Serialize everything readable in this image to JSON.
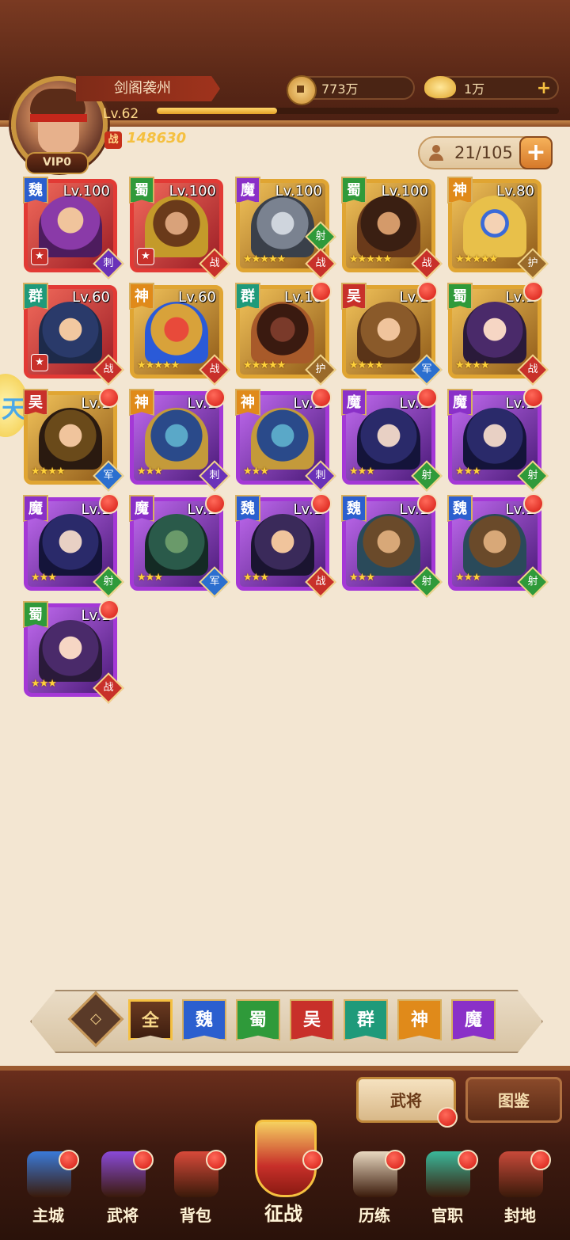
{
  "player": {
    "name": "剑阁袭州",
    "level": "Lv.62",
    "vip": "VIP0",
    "power": "148630",
    "power_icon": "战",
    "xp_fraction": 0.3
  },
  "resources": {
    "copper": "773万",
    "gold": "1万"
  },
  "capacity": "21/105",
  "heroes": [
    {
      "faction": "魏",
      "fclass": "f-wei",
      "lv": "Lv.100",
      "border": "red",
      "stars": "",
      "starbadge": "★",
      "role": "刺",
      "rclass": "r-ci",
      "dot": false,
      "p": "p1"
    },
    {
      "faction": "蜀",
      "fclass": "f-shu",
      "lv": "Lv.100",
      "border": "red",
      "stars": "",
      "starbadge": "★",
      "role": "战",
      "rclass": "r-zhan",
      "dot": false,
      "p": "p2"
    },
    {
      "faction": "魔",
      "fclass": "f-mo",
      "lv": "Lv.100",
      "border": "gold",
      "stars": "★★★★★",
      "starbadge": "",
      "role": "战",
      "rclass": "r-zhan",
      "dot": false,
      "p": "p3",
      "role2": "射",
      "r2class": "r-she"
    },
    {
      "faction": "蜀",
      "fclass": "f-shu",
      "lv": "Lv.100",
      "border": "gold",
      "stars": "★★★★★",
      "starbadge": "",
      "role": "战",
      "rclass": "r-zhan",
      "dot": false,
      "p": "p4"
    },
    {
      "faction": "神",
      "fclass": "f-shen",
      "lv": "Lv.80",
      "border": "gold",
      "stars": "★★★★★",
      "starbadge": "",
      "role": "护",
      "rclass": "r-hu",
      "dot": false,
      "p": "p5"
    },
    {
      "faction": "群",
      "fclass": "f-qun",
      "lv": "Lv.60",
      "border": "red",
      "stars": "",
      "starbadge": "★",
      "role": "战",
      "rclass": "r-zhan",
      "dot": false,
      "p": "p6"
    },
    {
      "faction": "神",
      "fclass": "f-shen",
      "lv": "Lv.60",
      "border": "gold",
      "stars": "★★★★★",
      "starbadge": "",
      "role": "战",
      "rclass": "r-zhan",
      "dot": false,
      "p": "p7"
    },
    {
      "faction": "群",
      "fclass": "f-qun",
      "lv": "Lv.10",
      "border": "gold",
      "stars": "★★★★★",
      "starbadge": "",
      "role": "护",
      "rclass": "r-hu",
      "dot": true,
      "p": "p8"
    },
    {
      "faction": "吴",
      "fclass": "f-wu",
      "lv": "Lv.1",
      "border": "gold",
      "stars": "★★★★",
      "starbadge": "",
      "role": "军",
      "rclass": "r-jun",
      "dot": true,
      "p": "p9"
    },
    {
      "faction": "蜀",
      "fclass": "f-shu",
      "lv": "Lv.1",
      "border": "gold",
      "stars": "★★★★",
      "starbadge": "",
      "role": "战",
      "rclass": "r-zhan",
      "dot": true,
      "p": "p10"
    },
    {
      "faction": "吴",
      "fclass": "f-wu",
      "lv": "Lv.1",
      "border": "gold",
      "stars": "★★★★",
      "starbadge": "",
      "role": "军",
      "rclass": "r-jun",
      "dot": true,
      "p": "p11"
    },
    {
      "faction": "神",
      "fclass": "f-shen",
      "lv": "Lv.1",
      "border": "purple",
      "stars": "★★★",
      "starbadge": "",
      "role": "刺",
      "rclass": "r-ci",
      "dot": true,
      "p": "p12"
    },
    {
      "faction": "神",
      "fclass": "f-shen",
      "lv": "Lv.1",
      "border": "purple",
      "stars": "★★★",
      "starbadge": "",
      "role": "刺",
      "rclass": "r-ci",
      "dot": true,
      "p": "p12"
    },
    {
      "faction": "魔",
      "fclass": "f-mo",
      "lv": "Lv.1",
      "border": "purple",
      "stars": "★★★",
      "starbadge": "",
      "role": "射",
      "rclass": "r-she",
      "dot": true,
      "p": "p13"
    },
    {
      "faction": "魔",
      "fclass": "f-mo",
      "lv": "Lv.1",
      "border": "purple",
      "stars": "★★★",
      "starbadge": "",
      "role": "射",
      "rclass": "r-she",
      "dot": true,
      "p": "p13"
    },
    {
      "faction": "魔",
      "fclass": "f-mo",
      "lv": "Lv.1",
      "border": "purple",
      "stars": "★★★",
      "starbadge": "",
      "role": "射",
      "rclass": "r-she",
      "dot": true,
      "p": "p13"
    },
    {
      "faction": "魔",
      "fclass": "f-mo",
      "lv": "Lv.1",
      "border": "purple",
      "stars": "★★★",
      "starbadge": "",
      "role": "军",
      "rclass": "r-jun",
      "dot": true,
      "p": "p14"
    },
    {
      "faction": "魏",
      "fclass": "f-wei",
      "lv": "Lv.1",
      "border": "purple",
      "stars": "★★★",
      "starbadge": "",
      "role": "战",
      "rclass": "r-zhan",
      "dot": true,
      "p": "p15"
    },
    {
      "faction": "魏",
      "fclass": "f-wei",
      "lv": "Lv.1",
      "border": "purple",
      "stars": "★★★",
      "starbadge": "",
      "role": "射",
      "rclass": "r-she",
      "dot": true,
      "p": "p16"
    },
    {
      "faction": "魏",
      "fclass": "f-wei",
      "lv": "Lv.1",
      "border": "purple",
      "stars": "★★★",
      "starbadge": "",
      "role": "射",
      "rclass": "r-she",
      "dot": true,
      "p": "p16"
    },
    {
      "faction": "蜀",
      "fclass": "f-shu",
      "lv": "Lv.1",
      "border": "purple",
      "stars": "★★★",
      "starbadge": "",
      "role": "战",
      "rclass": "r-zhan",
      "dot": true,
      "p": "p10"
    }
  ],
  "filters": [
    {
      "label": "全",
      "cls": "all"
    },
    {
      "label": "魏",
      "cls": "f-wei"
    },
    {
      "label": "蜀",
      "cls": "f-shu"
    },
    {
      "label": "吴",
      "cls": "f-wu"
    },
    {
      "label": "群",
      "cls": "f-qun"
    },
    {
      "label": "神",
      "cls": "f-shen"
    },
    {
      "label": "魔",
      "cls": "f-mo"
    }
  ],
  "sub_tabs": {
    "heroes": "武将",
    "codex": "图鉴"
  },
  "nav": [
    {
      "label": "主城",
      "name": "nav-main-city",
      "color": "#3a7ad8"
    },
    {
      "label": "武将",
      "name": "nav-heroes",
      "color": "#8a4ad8"
    },
    {
      "label": "背包",
      "name": "nav-bag",
      "color": "#d84a3a"
    },
    {
      "label": "征战",
      "name": "nav-campaign",
      "color": ""
    },
    {
      "label": "历练",
      "name": "nav-training",
      "color": "#e8d8c0"
    },
    {
      "label": "官职",
      "name": "nav-office",
      "color": "#3ab89a"
    },
    {
      "label": "封地",
      "name": "nav-fief",
      "color": "#c84a3a"
    }
  ]
}
